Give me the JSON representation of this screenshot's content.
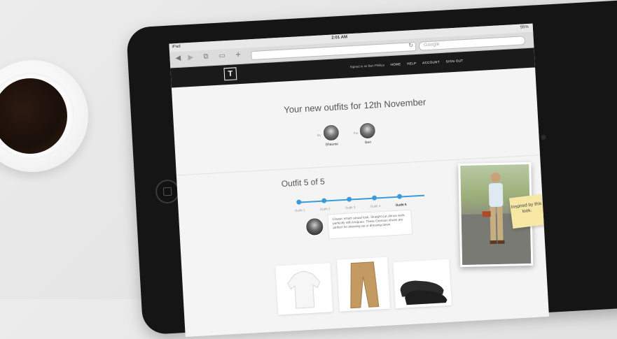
{
  "status_bar": {
    "carrier": "iPad",
    "time": "2:01 AM",
    "battery": "95%"
  },
  "browser": {
    "search_placeholder": "Google"
  },
  "site": {
    "logo_letter": "T",
    "signed_in_text": "Signed in as Ben Phillips",
    "menu": [
      "HOME",
      "HELP",
      "ACCOUNT",
      "SIGN OUT"
    ]
  },
  "headline": "Your new outfits for 12th November",
  "by_label": "By",
  "for_label": "For",
  "stylist_name": "Shaunie",
  "client_name": "Ben",
  "outfit_title": "Outfit 5 of 5",
  "steps": [
    "Outfit 1",
    "Outfit 2",
    "Outfit 3",
    "Outfit 4",
    "Outfit 5"
  ],
  "note_text": "Classic smart casual look. Straight cut chinos work perfectly with brogues. These Grenson shoes are perfect for dressing up or dressing down.",
  "postit_text": "Inspired by this look."
}
